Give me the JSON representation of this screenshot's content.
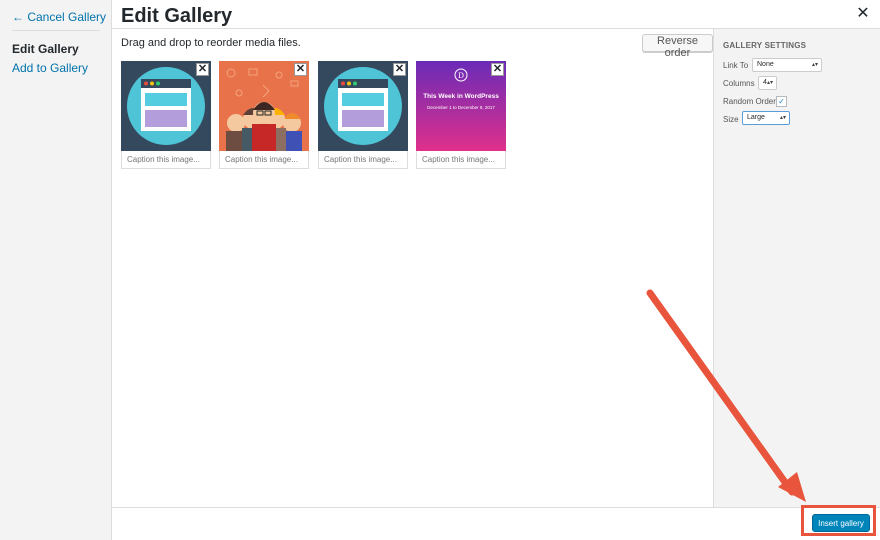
{
  "sidebar": {
    "cancel_label": "← Cancel Gallery",
    "active_label": "Edit Gallery",
    "add_label": "Add to Gallery"
  },
  "header": {
    "title": "Edit Gallery",
    "close_icon": "close-icon"
  },
  "main": {
    "instructions": "Drag and drop to reorder media files.",
    "reverse_label": "Reverse order",
    "attachments": [
      {
        "kind": "browser-graphic",
        "caption_placeholder": "Caption this image..."
      },
      {
        "kind": "people-illustration",
        "caption_placeholder": "Caption this image..."
      },
      {
        "kind": "browser-graphic",
        "caption_placeholder": "Caption this image..."
      },
      {
        "kind": "wordpress-banner",
        "banner_title": "This Week in WordPress",
        "banner_dates": "December 1 to December 8, 2017",
        "caption_placeholder": "Caption this image..."
      }
    ]
  },
  "settings": {
    "heading": "GALLERY SETTINGS",
    "link_to_label": "Link To",
    "link_to_value": "None",
    "columns_label": "Columns",
    "columns_value": "4",
    "random_label": "Random Order",
    "random_checked": true,
    "size_label": "Size",
    "size_value": "Large"
  },
  "footer": {
    "insert_label": "Insert gallery"
  },
  "colors": {
    "accent": "#0085ba",
    "link": "#0073aa",
    "annotation": "#e8553c"
  }
}
